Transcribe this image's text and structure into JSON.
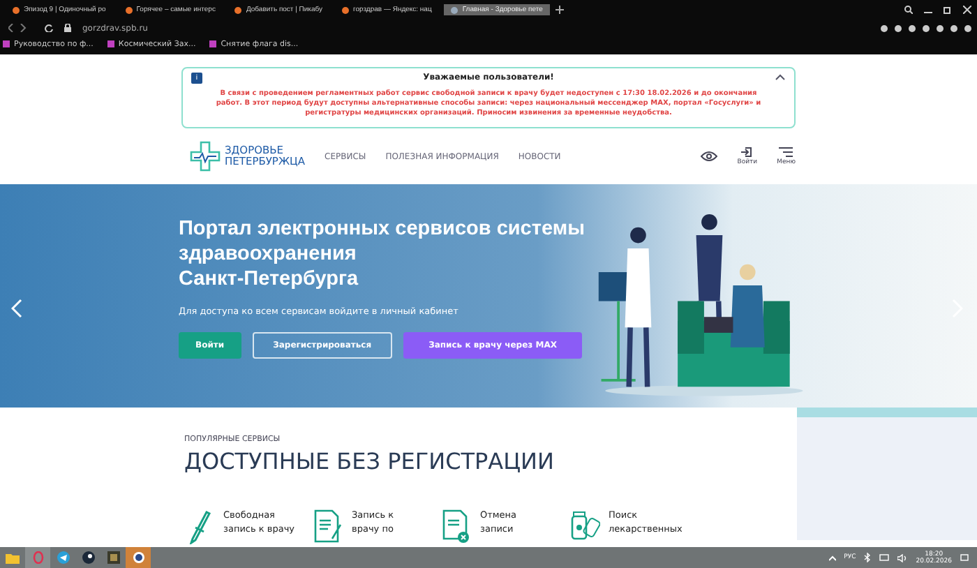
{
  "browser": {
    "tabs": [
      {
        "title": "Эпизод 9 | Одиночный ро",
        "selected": false
      },
      {
        "title": "Горячее – самые интерс",
        "selected": false
      },
      {
        "title": "Добавить пост | Пикабу",
        "selected": false
      },
      {
        "title": "горздрав — Яндекс: нац",
        "selected": false
      },
      {
        "title": "Главная - Здоровье пете",
        "selected": true
      }
    ],
    "url": "gorzdrav.spb.ru",
    "bookmarks": [
      "Руководство по ф...",
      "Космический Зах...",
      "Снятие флага dis..."
    ]
  },
  "notice": {
    "badge": "i",
    "title": "Уважаемые пользователи!",
    "text": "В связи с проведением регламентных работ сервис свободной записи к врачу будет недоступен с 17:30 18.02.2026 и до окончания работ. В этот период будут доступны альтернативные способы записи: через национальный мессенджер MAX, портал «Госуслуги» и регистратуры медицинских организаций. Приносим извинения за временные неудобства.",
    "expanded": true
  },
  "header": {
    "logo_top": "ЗДОРОВЬЕ",
    "logo_bottom": "ПЕТЕРБУРЖЦА",
    "nav": [
      "СЕРВИСЫ",
      "ПОЛЕЗНАЯ ИНФОРМАЦИЯ",
      "НОВОСТИ"
    ],
    "login": "Войти",
    "menu": "Меню"
  },
  "hero": {
    "title": "Портал электронных сервисов системы\nздравоохранения\nСанкт-Петербурга",
    "subtitle": "Для доступа ко всем сервисам войдите в личный кабинет",
    "buttons": [
      {
        "label": "Войти",
        "kind": "primary"
      },
      {
        "label": "Зарегистрироваться",
        "kind": "outline"
      },
      {
        "label": "Запись к врачу через MAX",
        "kind": "accent"
      }
    ]
  },
  "services": {
    "eyebrow": "ПОПУЛЯРНЫЕ СЕРВИСЫ",
    "heading": "ДОСТУПНЫЕ БЕЗ РЕГИСТРАЦИИ",
    "items": [
      {
        "label": "Свободная\nзапись к врачу",
        "kind": "pen"
      },
      {
        "label": "Запись к\nврачу по",
        "kind": "doc"
      },
      {
        "label": "Отмена\nзаписи",
        "kind": "cancel"
      },
      {
        "label": "Поиск\nлекарственных",
        "kind": "pills"
      }
    ]
  },
  "taskbar": {
    "lang": "РУС",
    "time": "18:20",
    "date": "20.02.2026"
  }
}
